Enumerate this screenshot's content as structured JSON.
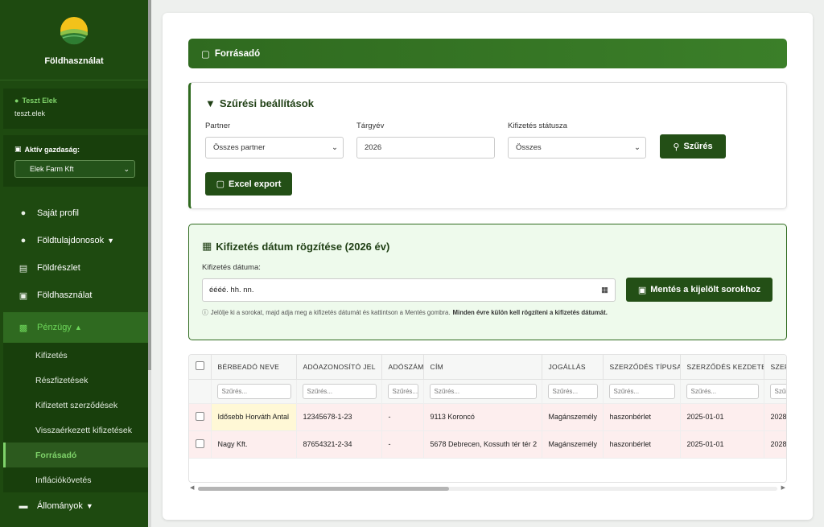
{
  "app": {
    "brand": "Földhasználat"
  },
  "user": {
    "name": "Teszt Elek",
    "login": "teszt.elek"
  },
  "farm": {
    "label": "Aktív gazdaság:",
    "selected": "Elek Farm Kft"
  },
  "nav": {
    "items": [
      {
        "label": "Saját profil",
        "icon": "user-circle-icon"
      },
      {
        "label": "Földtulajdonosok",
        "icon": "users-icon"
      },
      {
        "label": "Földrészlet",
        "icon": "map-icon"
      },
      {
        "label": "Földhasználat",
        "icon": "tractor-icon"
      },
      {
        "label": "Pénzügy",
        "icon": "money-icon"
      },
      {
        "label": "Állományok",
        "icon": "folder-icon"
      }
    ],
    "sub_items": [
      "Kifizetés",
      "Részfizetések",
      "Kifizetett szerződések",
      "Visszaérkezett kifizetések",
      "Forrásadó",
      "Inflációkövetés"
    ]
  },
  "page": {
    "title": "Forrásadó"
  },
  "filters": {
    "title": "Szűrési beállítások",
    "partner_label": "Partner",
    "partner_value": "Összes partner",
    "year_label": "Tárgyév",
    "year_value": "2026",
    "status_label": "Kifizetés státusza",
    "status_value": "Összes",
    "filter_button": "Szűrés",
    "export_button": "Excel export"
  },
  "payment": {
    "title": "Kifizetés dátum rögzítése (2026 év)",
    "date_label": "Kifizetés dátuma:",
    "date_placeholder": "éééé. hh. nn.",
    "save_button": "Mentés a kijelölt sorokhoz",
    "hint_prefix": "Jelölje ki a sorokat, majd adja meg a kifizetés dátumát és kattintson a Mentés gombra.",
    "hint_bold": "Minden évre külön kell rögzíteni a kifizetés dátumát."
  },
  "table": {
    "columns": [
      "Bérbeadó neve",
      "Adóazonosító jel",
      "Adószám",
      "Cím",
      "Jogállás",
      "Szerződés típusa",
      "Szerződés kezdete",
      "Szer"
    ],
    "filter_placeholder": "Szűrés...",
    "rows": [
      {
        "name": "Idősebb Horváth Antal",
        "tax_id": "12345678-1-23",
        "tax_no": "-",
        "address": "9113 Koroncó",
        "status": "Magánszemély",
        "type": "haszonbérlet",
        "start": "2025-01-01",
        "end": "2028"
      },
      {
        "name": "Nagy Kft.",
        "tax_id": "87654321-2-34",
        "tax_no": "-",
        "address": "5678 Debrecen, Kossuth tér tér 2",
        "status": "Magánszemély",
        "type": "haszonbérlet",
        "start": "2025-01-01",
        "end": "2028"
      }
    ]
  },
  "colors": {
    "sidebar": "#1e4a10",
    "accent": "#2f6a1f",
    "active_text": "#6ed85a",
    "highlight_row": "#fdeeee"
  }
}
